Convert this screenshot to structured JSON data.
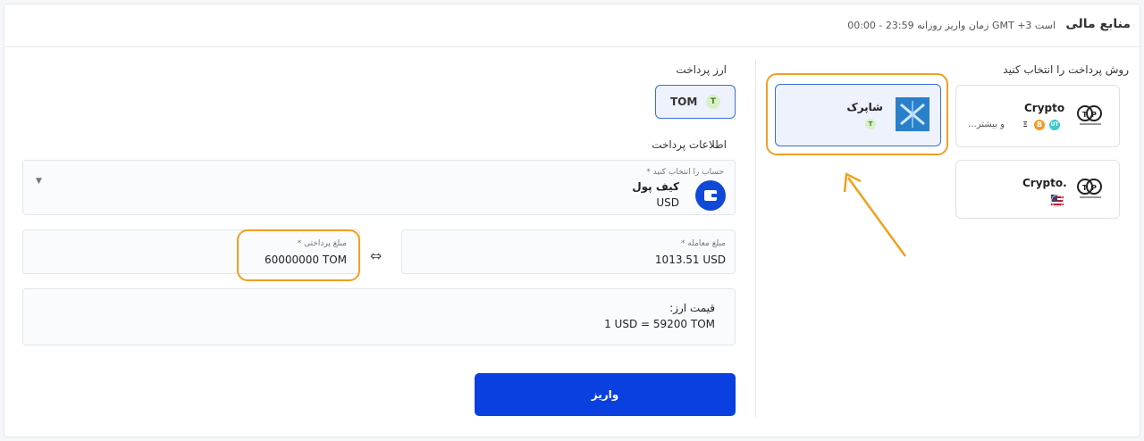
{
  "header": {
    "title": "منابع مالی",
    "subtitle": "زمان واریز روزانه 23:59 - 00:00 GMT +3 است"
  },
  "methods": {
    "section_label": "روش پرداخت را انتخاب کنید",
    "items": [
      {
        "name": "Crypto",
        "extra": "و بیشتر...",
        "coins": [
          "UT",
          "B",
          "Ξ"
        ]
      },
      {
        "name": "شاپرک",
        "badge": "T"
      },
      {
        "name": "Crypto."
      }
    ]
  },
  "currency": {
    "label": "ارز پرداخت",
    "value": "TOM",
    "badge": "T"
  },
  "payment_info": {
    "label": "اطلاعات پرداخت",
    "account_label": "حساب را انتخاب کنید *",
    "account_name": "کیف پول",
    "account_currency": "USD"
  },
  "amounts": {
    "deal_label": "مبلغ معامله *",
    "deal_value": "1013.51 USD",
    "pay_label": "مبلغ پرداختی *",
    "pay_value": "60000000 TOM"
  },
  "rate": {
    "label": "قیمت ارز:",
    "value": "1 USD = 59200 TOM"
  },
  "submit_label": "واریز",
  "colors": {
    "accent": "#0a3fe0",
    "highlight": "#f0a020"
  }
}
